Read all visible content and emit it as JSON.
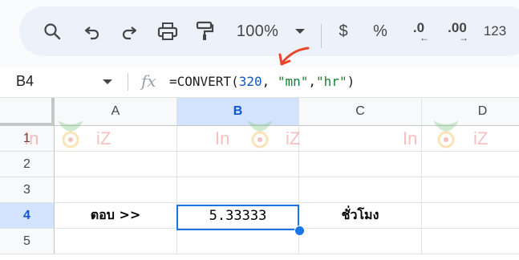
{
  "toolbar": {
    "zoom": "100%",
    "currency": "$",
    "percent": "%",
    "decrease_decimal": ".0",
    "increase_decimal": ".00",
    "more_formats": "123"
  },
  "formula_bar": {
    "name_box": "B4",
    "fx": "fx",
    "formula_prefix": "=CONVERT(",
    "formula_num": "320",
    "formula_sep": ", ",
    "formula_str1": "\"mn\"",
    "formula_comma": ",",
    "formula_str2": "\"hr\"",
    "formula_close": ")"
  },
  "columns": [
    "A",
    "B",
    "C",
    "D"
  ],
  "rows": [
    "1",
    "2",
    "3",
    "4",
    "5"
  ],
  "cells": {
    "A4": "ตอบ >>",
    "B4": "5.33333",
    "C4": "ชั่วโมง"
  },
  "watermark": {
    "left": "In",
    "right": "iZ"
  },
  "colors": {
    "accent": "#1a73e8",
    "selected_header": "#d3e3fd",
    "toolbar_bg": "#edf2fa",
    "annotation_arrow": "#e8472b"
  },
  "icons": [
    "search-icon",
    "undo-icon",
    "redo-icon",
    "print-icon",
    "paint-format-icon",
    "zoom-dropdown-icon"
  ]
}
